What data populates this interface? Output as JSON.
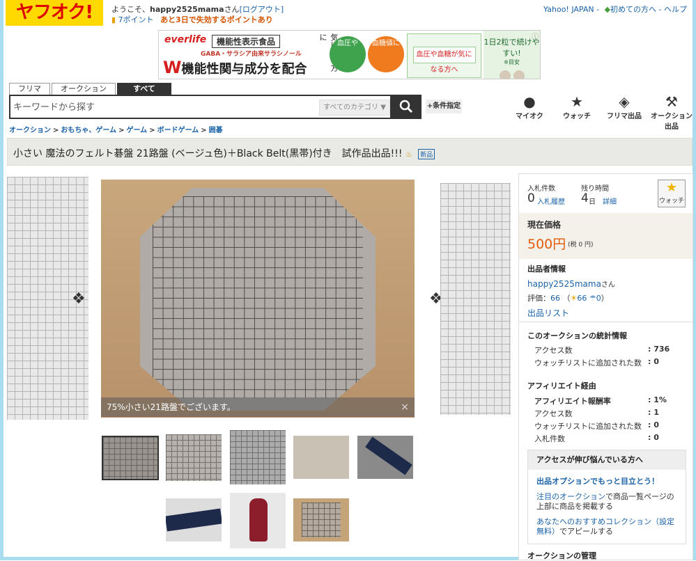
{
  "header": {
    "logo": "ヤフオク!",
    "welcome_prefix": "ようこそ、",
    "username": "happy2525mama",
    "welcome_suffix": "さん",
    "logout": "[ログアウト]",
    "points": "7ポイント",
    "points_warning": "あと3日で失効するポイントあり",
    "top_links": [
      "Yahoo! JAPAN -",
      "初めての方へ -",
      "ヘルプ"
    ]
  },
  "banner": {
    "brand": "everlife",
    "category": "機能性表示食品",
    "subtitle": "GABA・サラシア由来サラシノール",
    "main_w": "W",
    "main_text": "機能性関与成分を配合",
    "side": "気になる方に",
    "circle1": "血圧や",
    "circle2": "血糖値に",
    "product_text": "血圧や血糖が気になる方へ",
    "right_text": "1日2粒で続けやすい!",
    "right_note": "※目安"
  },
  "tabs": [
    {
      "label": "フリマ",
      "active": false
    },
    {
      "label": "オークション",
      "active": false
    },
    {
      "label": "すべて",
      "active": true
    }
  ],
  "search": {
    "placeholder": "キーワードから探す",
    "category": "すべてのカテゴリ",
    "search_icon": "search-icon",
    "conditions": "+条件指定"
  },
  "nav_icons": [
    {
      "icon": "person-icon",
      "label": "マイオク"
    },
    {
      "icon": "star-icon",
      "label": "ウォッチ"
    },
    {
      "icon": "tag-icon",
      "label": "フリマ出品"
    },
    {
      "icon": "gavel-icon",
      "label": "オークション出品"
    }
  ],
  "breadcrumb": [
    "オークション",
    "おもちゃ、ゲーム",
    "ゲーム",
    "ボードゲーム",
    "囲碁"
  ],
  "item": {
    "title": "小さい 魔法のフェルト碁盤 21路盤 (ベージュ色)＋Black Belt(黒帯)付き　試作品出品!!!",
    "new_badge": "新品",
    "photo_caption": "75%小さい21路盤でございます。",
    "close": "×"
  },
  "status": {
    "bids_label": "入札件数",
    "bids": "0",
    "bid_history": "入札履歴",
    "time_label": "残り時間",
    "time_value": "4",
    "time_unit": "日",
    "time_detail": "詳細",
    "watch_label": "ウォッチ"
  },
  "price": {
    "label": "現在価格",
    "value": "500円",
    "tax": "(税 0 円)"
  },
  "seller": {
    "heading": "出品者情報",
    "name": "happy2525mama",
    "honorific": "さん",
    "rating_label": "評価：",
    "rating": "66",
    "good": "66",
    "bad": "0",
    "list_link": "出品リスト"
  },
  "stats": {
    "heading": "このオークションの統計情報",
    "rows": [
      {
        "label": "アクセス数",
        "value": ": 736"
      },
      {
        "label": "ウォッチリストに追加された数",
        "value": ": 0"
      }
    ]
  },
  "affiliate": {
    "heading": "アフィリエイト経由",
    "rows": [
      {
        "label": "アフィリエイト報酬率",
        "value": ": 1%"
      },
      {
        "label": "アクセス数",
        "value": ": 1"
      },
      {
        "label": "ウォッチリストに追加された数",
        "value": ": 0"
      },
      {
        "label": "入札件数",
        "value": ": 0"
      }
    ]
  },
  "boost": {
    "heading": "アクセスが伸び悩んでいる方へ",
    "line1": "出品オプションでもっと目立とう！",
    "line2_link": "注目のオークション",
    "line2_rest": "で商品一覧ページの上部に商品を掲載する",
    "line3_link": "あなたへのおすすめコレクション（設定無料）",
    "line3_rest": "でアピールする"
  },
  "manage_heading": "オークションの管理",
  "colors": {
    "accent_price": "#e25c0b",
    "link": "#1a62a8",
    "frame": "#aadcf0",
    "logo_bg": "#ffd900"
  }
}
